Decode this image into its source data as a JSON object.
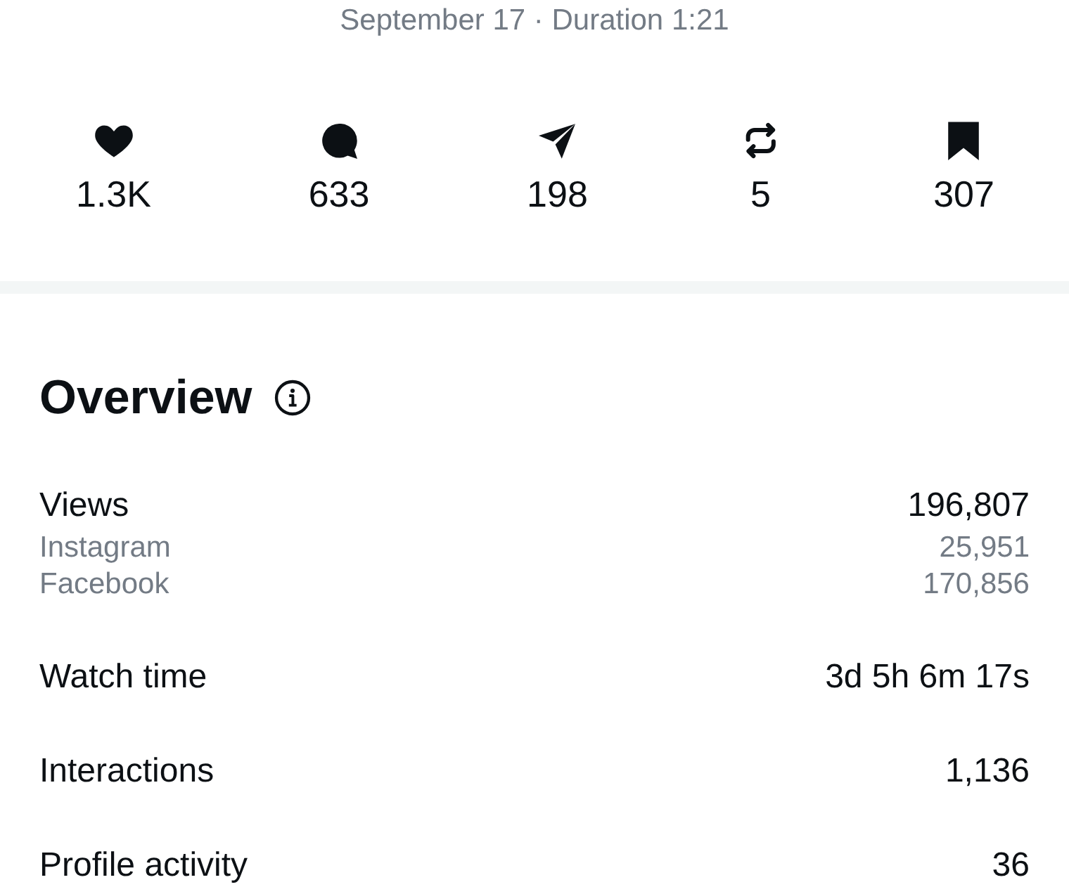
{
  "subtitle": "September 17 · Duration 1:21",
  "stats": [
    {
      "kind": "like",
      "value": "1.3K"
    },
    {
      "kind": "comment",
      "value": "633"
    },
    {
      "kind": "share",
      "value": "198"
    },
    {
      "kind": "repost",
      "value": "5"
    },
    {
      "kind": "save",
      "value": "307"
    }
  ],
  "overview": {
    "title": "Overview",
    "metrics": [
      {
        "label": "Views",
        "value": "196,807",
        "breakdown": [
          {
            "label": "Instagram",
            "value": "25,951"
          },
          {
            "label": "Facebook",
            "value": "170,856"
          }
        ]
      },
      {
        "label": "Watch time",
        "value": "3d 5h 6m 17s"
      },
      {
        "label": "Interactions",
        "value": "1,136"
      },
      {
        "label": "Profile activity",
        "value": "36"
      }
    ]
  }
}
